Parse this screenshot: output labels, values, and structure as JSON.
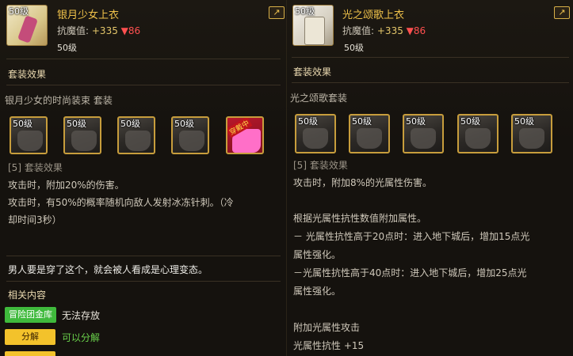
{
  "left": {
    "icon_level": "50级",
    "name": "银月少女上衣",
    "stat_label": "抗魔值:",
    "stat_up": "+335",
    "stat_down": "▼86",
    "level": "50级",
    "share_icon": "share-icon",
    "set_section_title": "套装效果",
    "set_name": "银月少女的时尚装束 套装",
    "slots": [
      {
        "level": "50级"
      },
      {
        "level": "50级"
      },
      {
        "level": "50级"
      },
      {
        "level": "50级"
      },
      {
        "level": "",
        "badge": "穿戴中"
      }
    ],
    "effect_header": "[5] 套装效果",
    "effect_lines": [
      "攻击时，附加20%的伤害。",
      "攻击时，有50%的概率随机向敌人发射冰冻针刺。（冷",
      "却时间3秒）"
    ],
    "flavor_text": "男人要是穿了这个，就会被人看成是心理变态。",
    "related_title": "相关内容",
    "tags": [
      {
        "button": "冒险团金库",
        "text": "无法存放",
        "text_color": "#e8e4da"
      },
      {
        "button": "分解",
        "text": "可以分解",
        "text_color": "#6ad14b"
      }
    ]
  },
  "right": {
    "icon_level": "50级",
    "name": "光之颂歌上衣",
    "stat_label": "抗魔值:",
    "stat_up": "+335",
    "stat_down": "▼86",
    "level": "50级",
    "share_icon": "share-icon",
    "set_section_title": "套装效果",
    "set_name": "光之颂歌套装",
    "slots": [
      {
        "level": "50级"
      },
      {
        "level": "50级"
      },
      {
        "level": "50级"
      },
      {
        "level": "50级"
      },
      {
        "level": "50级"
      }
    ],
    "effect_header": "[5] 套装效果",
    "effect_lines": [
      "攻击时，附加8%的光属性伤害。",
      "",
      "根据光属性抗性数值附加属性。",
      "－ 光属性抗性高于20点时：进入地下城后，增加15点光",
      "属性强化。",
      "－光属性抗性高于40点时：进入地下城后，增加25点光",
      "属性强化。",
      "",
      "附加光属性攻击",
      "光属性抗性 +15"
    ]
  }
}
